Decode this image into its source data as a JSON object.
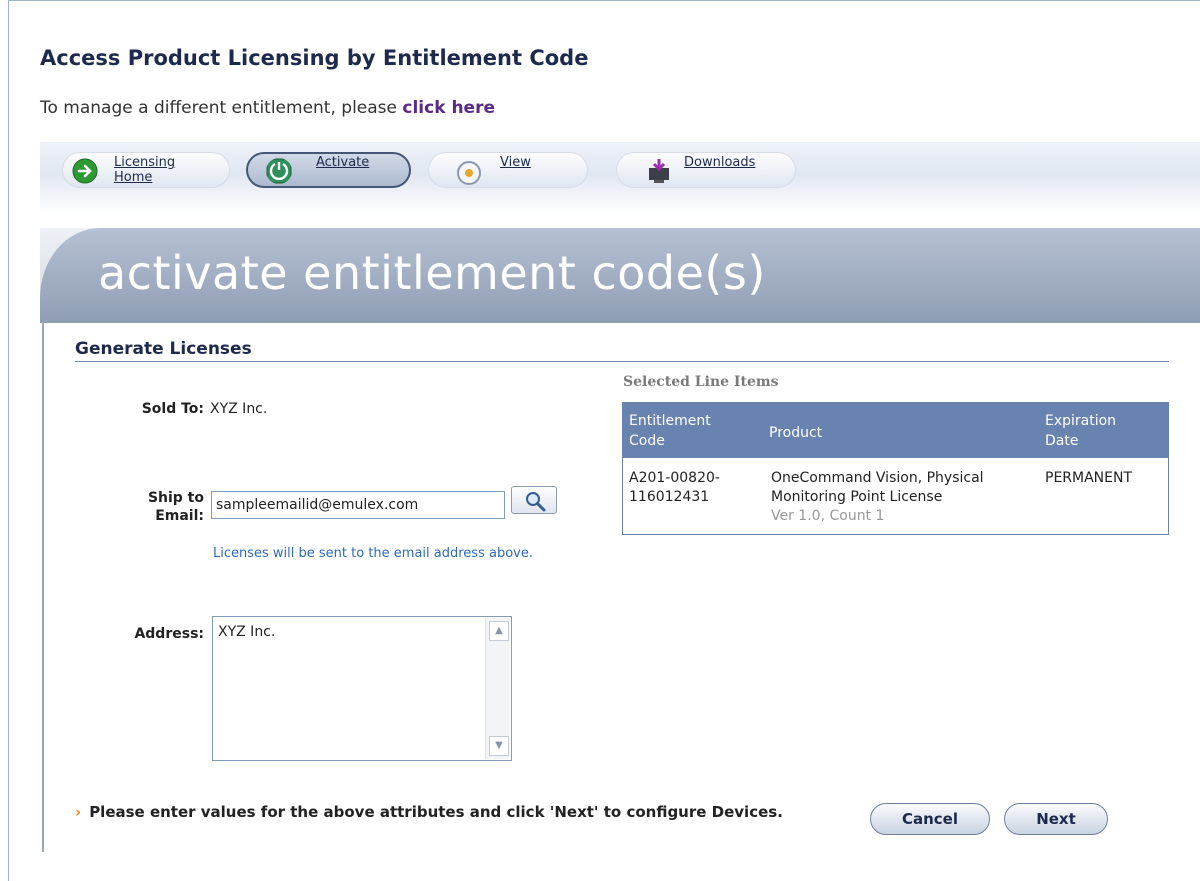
{
  "header": {
    "title": "Access Product Licensing by Entitlement Code",
    "subtitle_prefix": "To manage a different entitlement, please",
    "subtitle_link": "click here"
  },
  "nav": {
    "items": [
      {
        "label": "Licensing Home",
        "icon": "arrow-right-circle-icon",
        "active": false
      },
      {
        "label": "Activate",
        "icon": "activate-icon",
        "active": true
      },
      {
        "label": "View",
        "icon": "view-icon",
        "active": false
      },
      {
        "label": "Downloads",
        "icon": "downloads-icon",
        "active": false
      }
    ]
  },
  "banner": {
    "text": "activate entitlement code(s)"
  },
  "form": {
    "section_title": "Generate Licenses",
    "sold_to_label": "Sold To:",
    "sold_to_value": "XYZ Inc.",
    "ship_to_label_1": "Ship to",
    "ship_to_label_2": "Email:",
    "email_value": "sampleemailid@emulex.com",
    "email_hint": "Licenses will be sent to the email address above.",
    "address_label": "Address:",
    "address_value": "XYZ Inc."
  },
  "line_items": {
    "title": "Selected Line Items",
    "columns": [
      "Entitlement Code",
      "Product",
      "Expiration Date"
    ],
    "rows": [
      {
        "code_1": "A201-00820-",
        "code_2": "116012431",
        "product_1": "OneCommand Vision, Physical",
        "product_2": "Monitoring Point License",
        "product_meta": "Ver 1.0, Count 1",
        "expiration": "PERMANENT"
      }
    ]
  },
  "footer": {
    "note": "Please enter values for the above attributes and click 'Next' to configure Devices.",
    "cancel_label": "Cancel",
    "next_label": "Next"
  },
  "colors": {
    "title": "#1d2a4c",
    "link": "#5b2a86",
    "hint": "#2d6bb8",
    "table_header": "#6883b0",
    "arrow_accent": "#e08a1e"
  }
}
